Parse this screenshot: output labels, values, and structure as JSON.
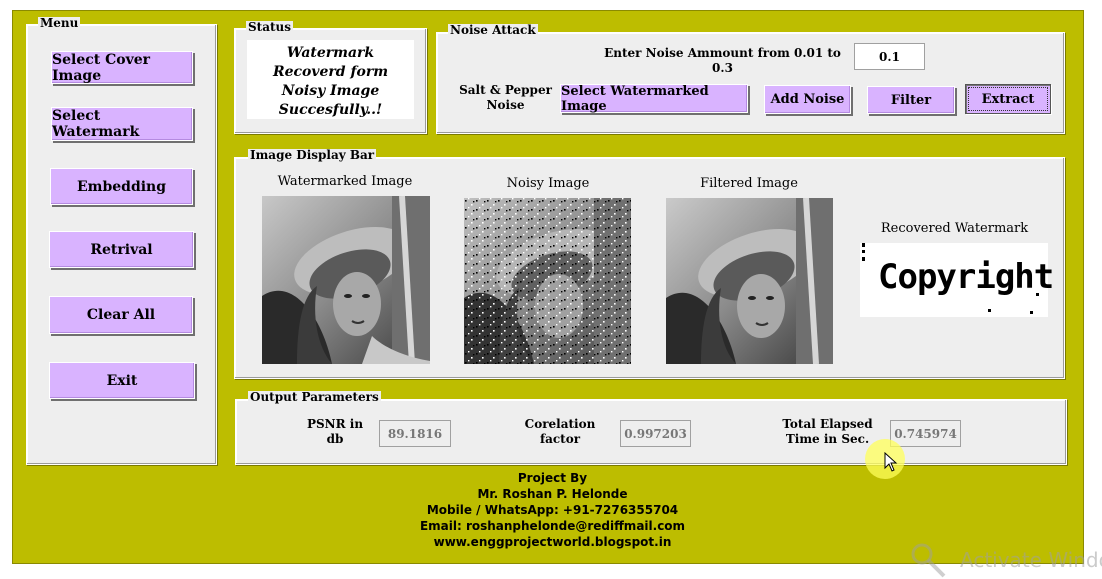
{
  "menu": {
    "title": "Menu",
    "buttons": [
      "Select Cover Image",
      "Select Watermark",
      "Embedding",
      "Retrival",
      "Clear All",
      "Exit"
    ]
  },
  "status": {
    "title": "Status",
    "message": "Watermark Recoverd form Noisy Image Succesfully..!"
  },
  "noise_attack": {
    "title": "Noise Attack",
    "prompt": "Enter Noise Ammount from 0.01 to 0.3",
    "value": "0.1",
    "type_label": "Salt & Pepper Noise",
    "btn_select": "Select Watermarked Image",
    "btn_add": "Add Noise",
    "btn_filter": "Filter",
    "btn_extract": "Extract"
  },
  "display": {
    "title": "Image Display Bar",
    "watermarked": "Watermarked Image",
    "noisy": "Noisy Image",
    "filtered": "Filtered Image",
    "recovered": "Recovered Watermark",
    "watermark_text": "Copyright"
  },
  "output": {
    "title": "Output Parameters",
    "psnr_label": "PSNR in db",
    "psnr_value": "89.1816",
    "corr_label": "Corelation factor",
    "corr_value": "0.997203",
    "time_label": "Total Elapsed Time in Sec.",
    "time_value": "0.745974"
  },
  "footer": {
    "line1": "Project By",
    "line2": "Mr. Roshan P. Helonde",
    "line3": "Mobile / WhatsApp: +91-7276355704",
    "line4": "Email: roshanphelonde@rediffmail.com",
    "line5": "www.enggprojectworld.blogspot.in"
  },
  "overlay": {
    "activate_text": "Activate Windo"
  },
  "colors": {
    "frame": "#bdbd00",
    "button": "#d9b3ff",
    "panel": "#eeeeee"
  }
}
